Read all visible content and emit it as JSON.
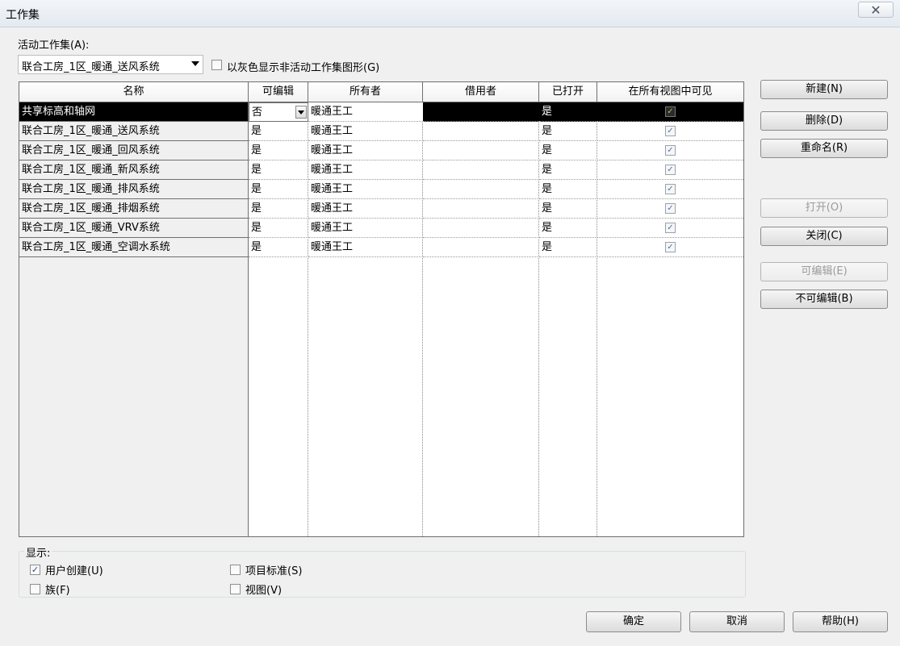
{
  "window": {
    "title": "工作集",
    "close_glyph": "✕"
  },
  "active_workset": {
    "label": "活动工作集(A):",
    "value": "联合工房_1区_暖通_送风系统",
    "gray_option": {
      "label": "以灰色显示非活动工作集图形(G)",
      "checked": false
    }
  },
  "table": {
    "columns": [
      "名称",
      "可编辑",
      "所有者",
      "借用者",
      "已打开",
      "在所有视图中可见"
    ],
    "rows": [
      {
        "name": "共享标高和轴网",
        "editable": "否",
        "owner": "暖通王工",
        "borrower": "",
        "opened": "是",
        "visible": true
      },
      {
        "name": "联合工房_1区_暖通_送风系统",
        "editable": "是",
        "owner": "暖通王工",
        "borrower": "",
        "opened": "是",
        "visible": true
      },
      {
        "name": "联合工房_1区_暖通_回风系统",
        "editable": "是",
        "owner": "暖通王工",
        "borrower": "",
        "opened": "是",
        "visible": true
      },
      {
        "name": "联合工房_1区_暖通_新风系统",
        "editable": "是",
        "owner": "暖通王工",
        "borrower": "",
        "opened": "是",
        "visible": true
      },
      {
        "name": "联合工房_1区_暖通_排风系统",
        "editable": "是",
        "owner": "暖通王工",
        "borrower": "",
        "opened": "是",
        "visible": true
      },
      {
        "name": "联合工房_1区_暖通_排烟系统",
        "editable": "是",
        "owner": "暖通王工",
        "borrower": "",
        "opened": "是",
        "visible": true
      },
      {
        "name": "联合工房_1区_暖通_VRV系统",
        "editable": "是",
        "owner": "暖通王工",
        "borrower": "",
        "opened": "是",
        "visible": true
      },
      {
        "name": "联合工房_1区_暖通_空调水系统",
        "editable": "是",
        "owner": "暖通王工",
        "borrower": "",
        "opened": "是",
        "visible": true
      }
    ]
  },
  "buttons": {
    "new": "新建(N)",
    "delete": "删除(D)",
    "rename": "重命名(R)",
    "open": "打开(O)",
    "close": "关闭(C)",
    "editable": "可编辑(E)",
    "non_editable": "不可编辑(B)",
    "ok": "确定",
    "cancel": "取消",
    "help": "帮助(H)"
  },
  "show": {
    "label": "显示:",
    "options": {
      "user_created": {
        "label": "用户创建(U)",
        "checked": true
      },
      "families": {
        "label": "族(F)",
        "checked": false
      },
      "project_standards": {
        "label": "项目标准(S)",
        "checked": false
      },
      "views": {
        "label": "视图(V)",
        "checked": false
      }
    }
  },
  "icons": {
    "check": "✓"
  }
}
